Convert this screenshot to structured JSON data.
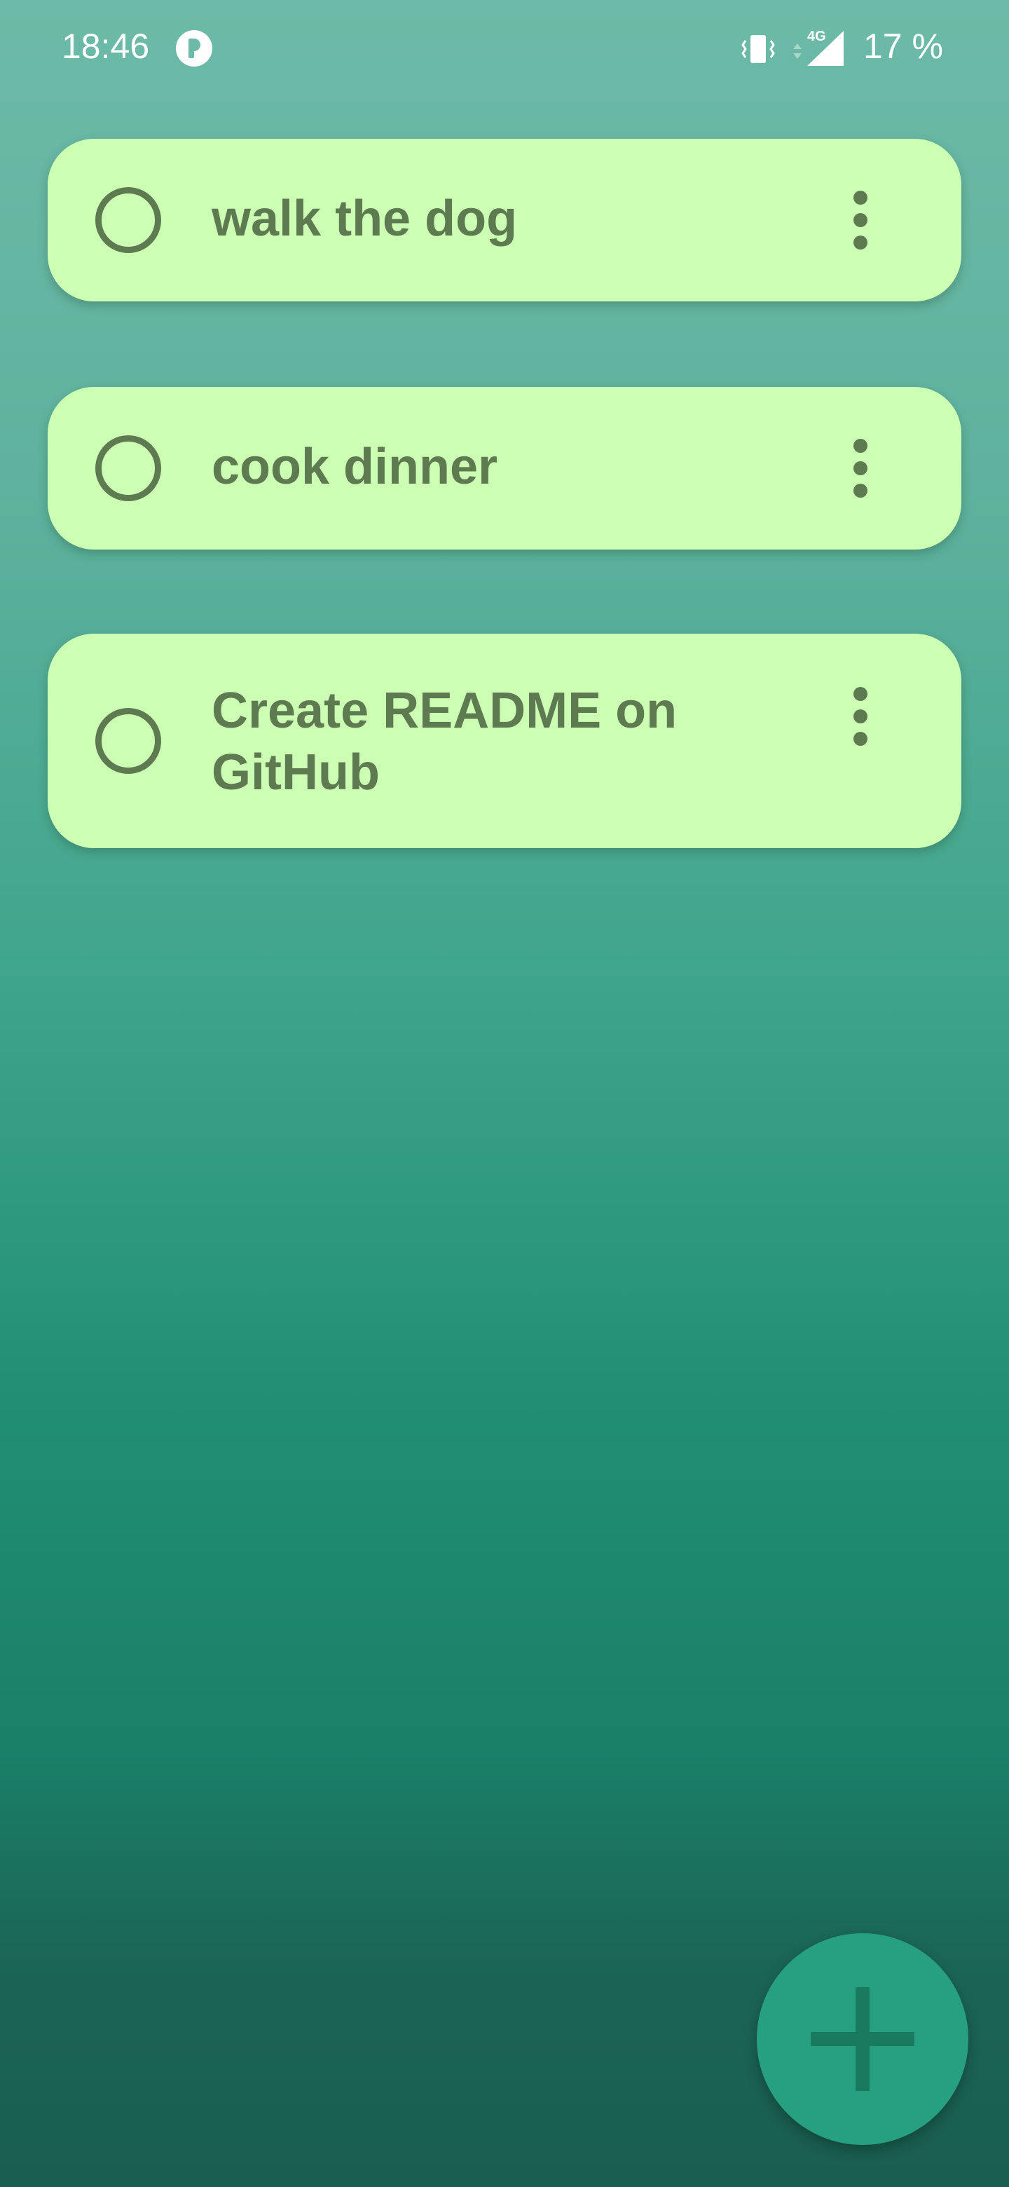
{
  "status_bar": {
    "time": "18:46",
    "battery": "17 %",
    "network_type": "4G",
    "icons": [
      "app-notification-icon",
      "vibrate-icon",
      "signal-icon"
    ]
  },
  "tasks": [
    {
      "title": "walk the dog",
      "completed": false
    },
    {
      "title": "cook dinner",
      "completed": false
    },
    {
      "title": "Create README on GitHub",
      "completed": false
    }
  ],
  "fab": {
    "icon": "plus-icon",
    "label": "+"
  },
  "colors": {
    "card_background": "#ccffb3",
    "card_text": "#5e7a51",
    "fab_background": "#27a07f",
    "fab_icon": "#1a7a5f",
    "gradient_top": "#6cbaa7",
    "gradient_bottom": "#1a5e4f"
  }
}
